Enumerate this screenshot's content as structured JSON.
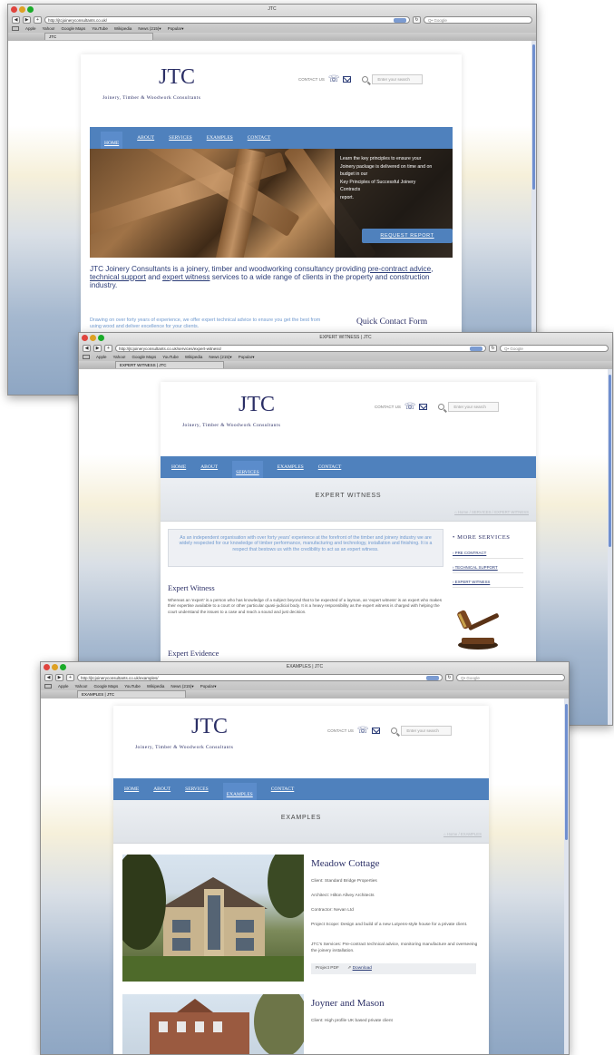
{
  "windows": [
    {
      "title": "JTC",
      "url": "http://jtcjoineryconsultants.co.uk/",
      "tab_label": "JTC",
      "google_placeholder": "Q• Google",
      "bookmarks": [
        "Apple",
        "Yahoo!",
        "Google Maps",
        "YouTube",
        "Wikipedia",
        "News (215)▾",
        "Popular▾"
      ],
      "site": {
        "logo": "JTC",
        "tagline": "Joinery, Timber & Woodwork Consultants",
        "contact_label": "CONTACT US",
        "search_placeholder": "Enter your search",
        "nav": [
          "HOME",
          "ABOUT",
          "SERVICES",
          "EXAMPLES",
          "CONTACT"
        ],
        "active_nav": "HOME"
      },
      "hero_text": [
        "Learn the key principles to ensure your",
        "Joinery package is delivered on time and on",
        "budget in our",
        "Key Principles of Successful Joinery",
        "Contracts",
        "report."
      ],
      "hero_button": "REQUEST REPORT",
      "intro_start": "JTC Joinery Consultants is a joinery, timber and woodworking consultancy providing ",
      "intro_link1": "pre-contract advice",
      "intro_sep": ", ",
      "intro_link2": "technical support",
      "intro_mid": " and ",
      "intro_link3": "expert witness",
      "intro_end": " services to a wide range of clients in the property and construction industry.",
      "lede": "Drawing on over forty years of experience, we offer expert technical advice to ensure you get the best from using wood and deliver excellence for your clients.",
      "quick_contact": "Quick Contact Form"
    },
    {
      "title": "EXPERT WITNESS | JTC",
      "url": "http://jtcjoineryconsultants.co.uk/services/expert-witness/",
      "tab_label": "EXPERT WITNESS | JTC",
      "google_placeholder": "Q• Google",
      "bookmarks": [
        "Apple",
        "Yahoo!",
        "Google Maps",
        "YouTube",
        "Wikipedia",
        "News (215)▾",
        "Popular▾"
      ],
      "site": {
        "logo": "JTC",
        "tagline": "Joinery, Timber & Woodwork Consultants",
        "contact_label": "CONTACT US",
        "search_placeholder": "Enter your search",
        "nav": [
          "HOME",
          "ABOUT",
          "SERVICES",
          "EXAMPLES",
          "CONTACT"
        ],
        "active_nav": "SERVICES"
      },
      "banner_title": "EXPERT WITNESS",
      "breadcrumb": "⌂ Home  /  SERVICES  /  EXPERT WITNESS",
      "quote": "As an independent organisation with over forty years' experience at the forefront of the timber and joinery industry we are widely respected for our knowledge of timber performance, manufacturing and technology, installation and finishing. It is a respect that bestows us with the credibility to act as an expert witness.",
      "heading1": "Expert Witness",
      "body1": "Whereas an 'expert' is a person who has knowledge of a subject beyond that to be expected of a layman, an 'expert witness' is an expert who makes their expertise available to a court or other particular quasi-judicial body. It is a heavy responsibility as the expert witness is charged with helping the court understand the issues to a case and reach a sound and just decision.",
      "heading2": "Expert Evidence",
      "sidebar_title": "• MORE SERVICES",
      "sidebar_links": [
        "› PRE CONTRACT",
        "› TECHNICAL SUPPORT",
        "› EXPERT WITNESS"
      ]
    },
    {
      "title": "EXAMPLES | JTC",
      "url": "http://jtcjoineryconsultants.co.uk/examples/",
      "tab_label": "EXAMPLES | JTC",
      "google_placeholder": "Q• Google",
      "bookmarks": [
        "Apple",
        "Yahoo!",
        "Google Maps",
        "YouTube",
        "Wikipedia",
        "News (215)▾",
        "Popular▾"
      ],
      "site": {
        "logo": "JTC",
        "tagline": "Joinery, Timber & Woodwork Consultants",
        "contact_label": "CONTACT US",
        "search_placeholder": "Enter your search",
        "nav": [
          "HOME",
          "ABOUT",
          "SERVICES",
          "EXAMPLES",
          "CONTACT"
        ],
        "active_nav": "EXAMPLES"
      },
      "banner_title": "EXAMPLES",
      "breadcrumb": "⌂ Home  /  EXAMPLES",
      "project1": {
        "title": "Meadow Cottage",
        "lines": [
          "Client: Standard Bridge Properties",
          "Architect: Hilton Allvey Architects",
          "Contractor: Nevan Ltd",
          "Project Scope: Design and build of a new Lutyens-style house for a private client.",
          "JTC's Services: Pre-contract technical advice, monitoring manufacture and overseeing the joinery installation."
        ],
        "pdf_label": "Project PDF",
        "pdf_link": "Download"
      },
      "project2": {
        "title": "Joyner and Mason",
        "line": "Client: High profile UK based private client"
      }
    }
  ],
  "colors": {
    "brand_navy": "#2b2f66",
    "nav_blue": "#4f81bd",
    "link_lightblue": "#6f99cf"
  }
}
